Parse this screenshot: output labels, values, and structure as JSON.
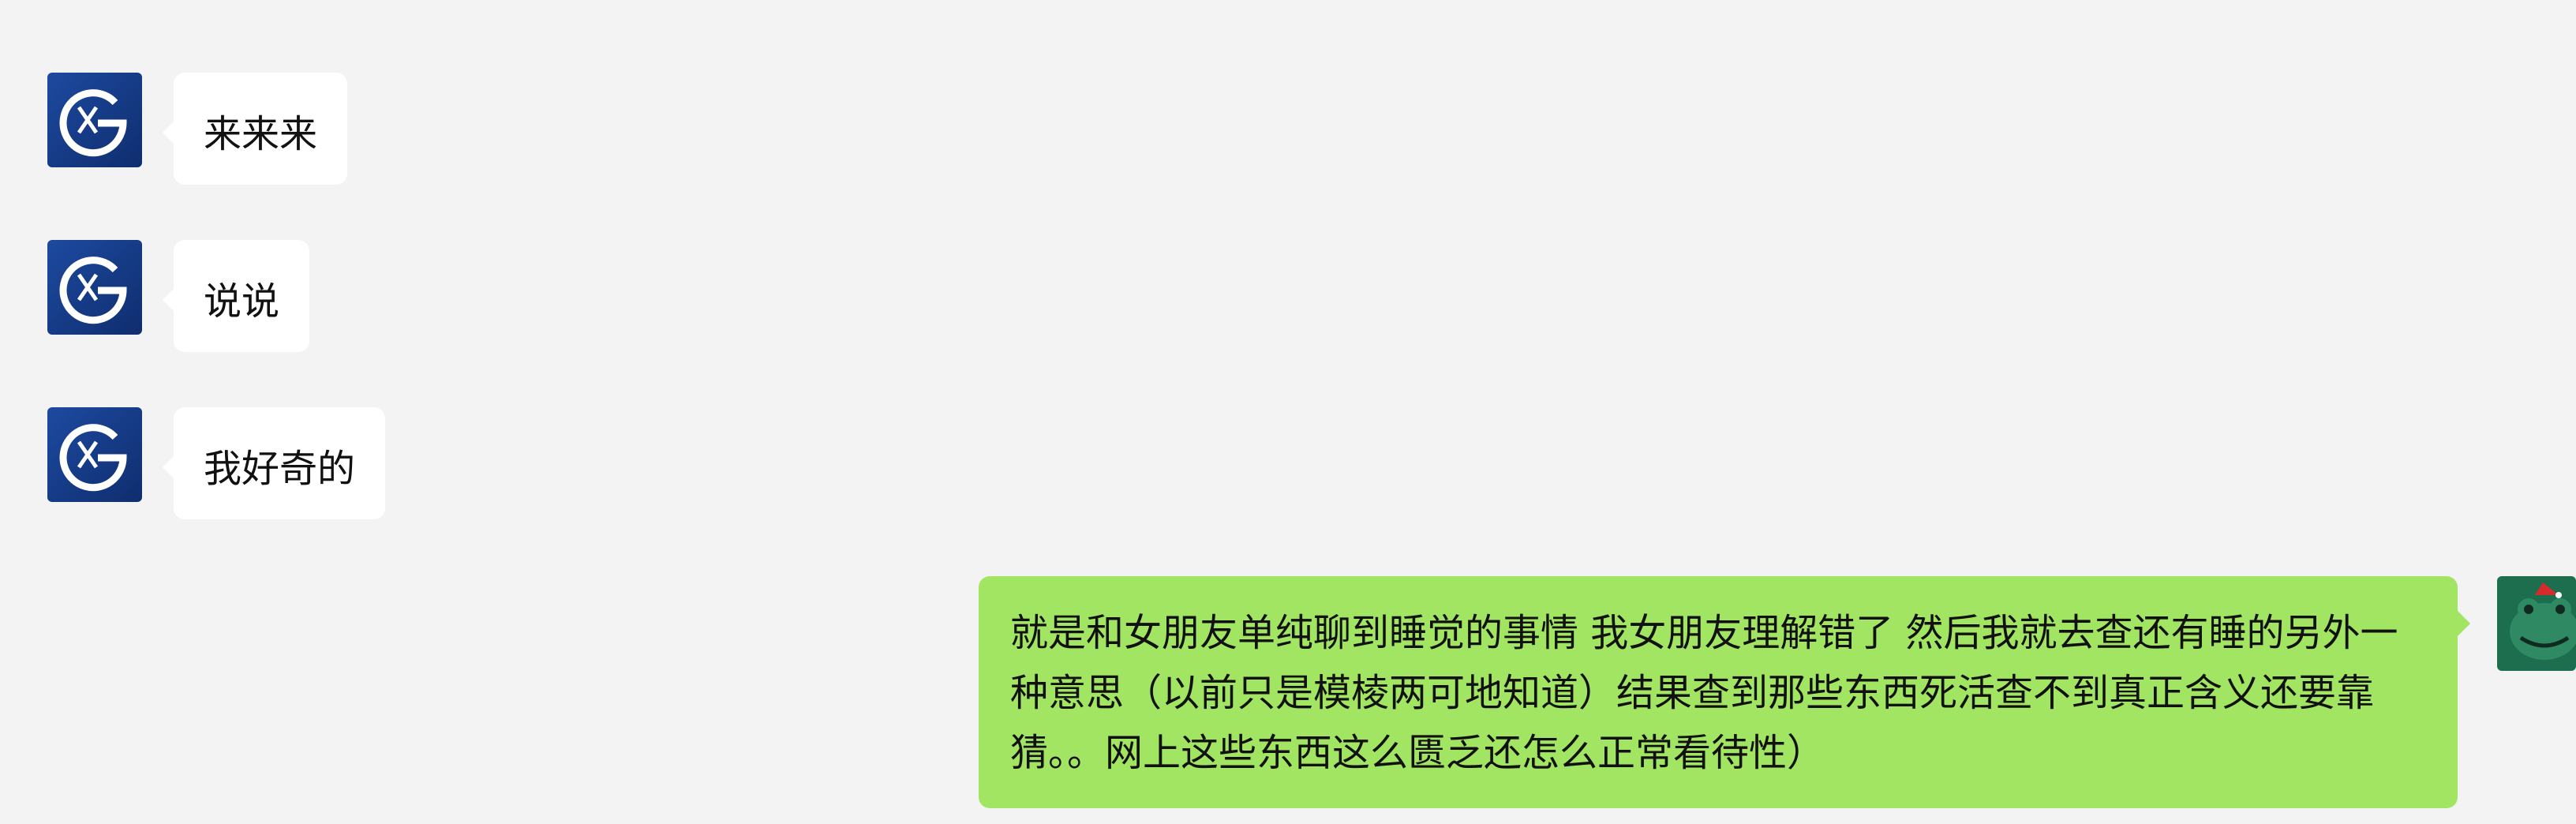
{
  "messages": [
    {
      "side": "left",
      "text": "来来来",
      "avatar": "xg-logo-icon"
    },
    {
      "side": "left",
      "text": "说说",
      "avatar": "xg-logo-icon"
    },
    {
      "side": "left",
      "text": "我好奇的",
      "avatar": "xg-logo-icon"
    },
    {
      "side": "right",
      "text": "就是和女朋友单纯聊到睡觉的事情 我女朋友理解错了 然后我就去查还有睡的另外一种意思（以前只是模棱两可地知道）结果查到那些东西死活查不到真正含义还要靠猜。。网上这些东西这么匮乏还怎么正常看待性）",
      "avatar": "frog-avatar-icon"
    }
  ],
  "colors": {
    "background": "#f3f3f3",
    "incoming_bubble": "#ffffff",
    "outgoing_bubble": "#a2e563",
    "logo_blue": "#1a3f8f"
  }
}
